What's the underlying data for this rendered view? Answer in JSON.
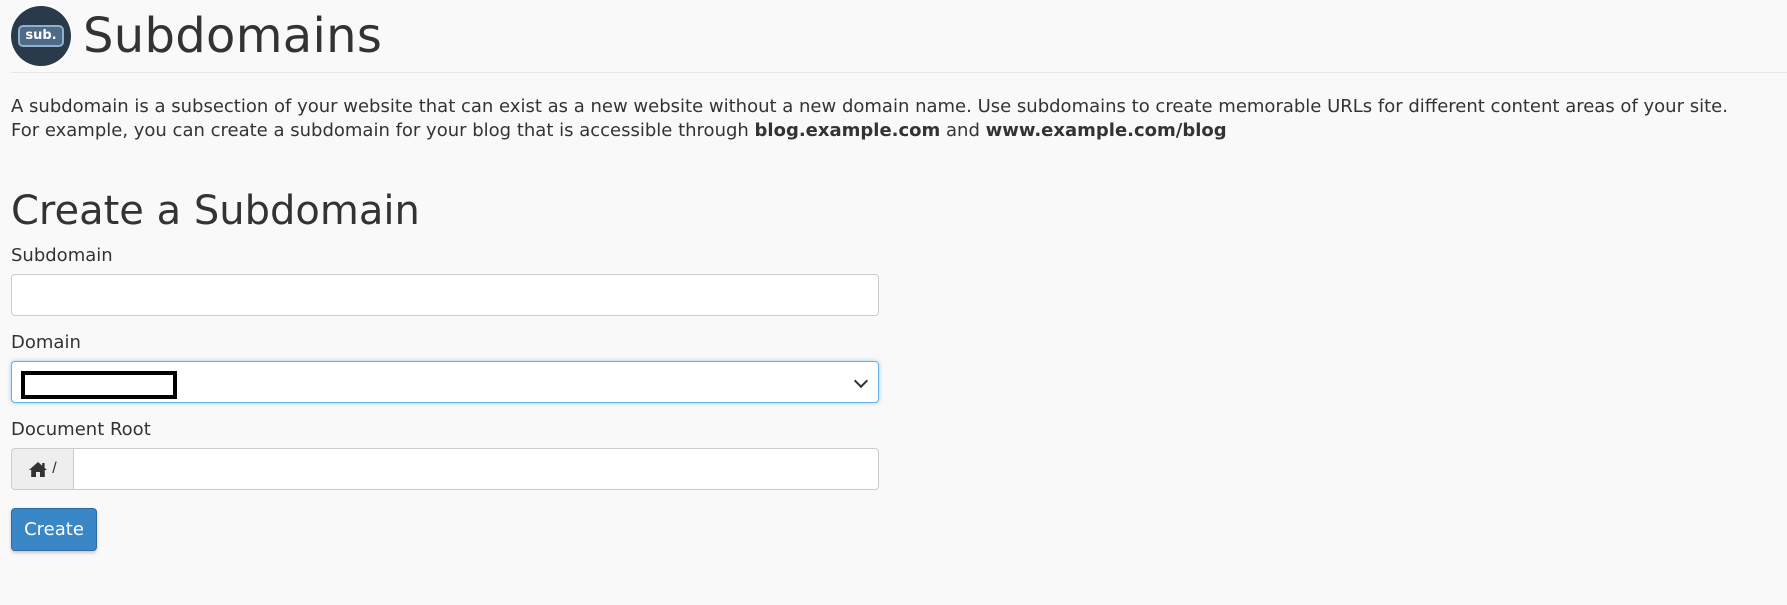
{
  "header": {
    "logo_text": "sub.",
    "title": "Subdomains"
  },
  "description": {
    "text_before": "A subdomain is a subsection of your website that can exist as a new website without a new domain name. Use subdomains to create memorable URLs for different content areas of your site. For example, you can create a subdomain for your blog that is accessible through ",
    "example_one": "blog.example.com",
    "joiner": " and ",
    "example_two": "www.example.com/blog"
  },
  "form": {
    "section_title": "Create a Subdomain",
    "subdomain_label": "Subdomain",
    "subdomain_value": "",
    "domain_label": "Domain",
    "document_root_label": "Document Root",
    "document_root_prefix": "/",
    "document_root_value": "",
    "create_button_label": "Create"
  },
  "icons": {
    "home": "home-icon",
    "select_arrow": "chevron-down-icon"
  },
  "colors": {
    "primary_button": "#3a87c8",
    "focus_border": "#66afe9",
    "logo_background": "#2b3a4a"
  }
}
